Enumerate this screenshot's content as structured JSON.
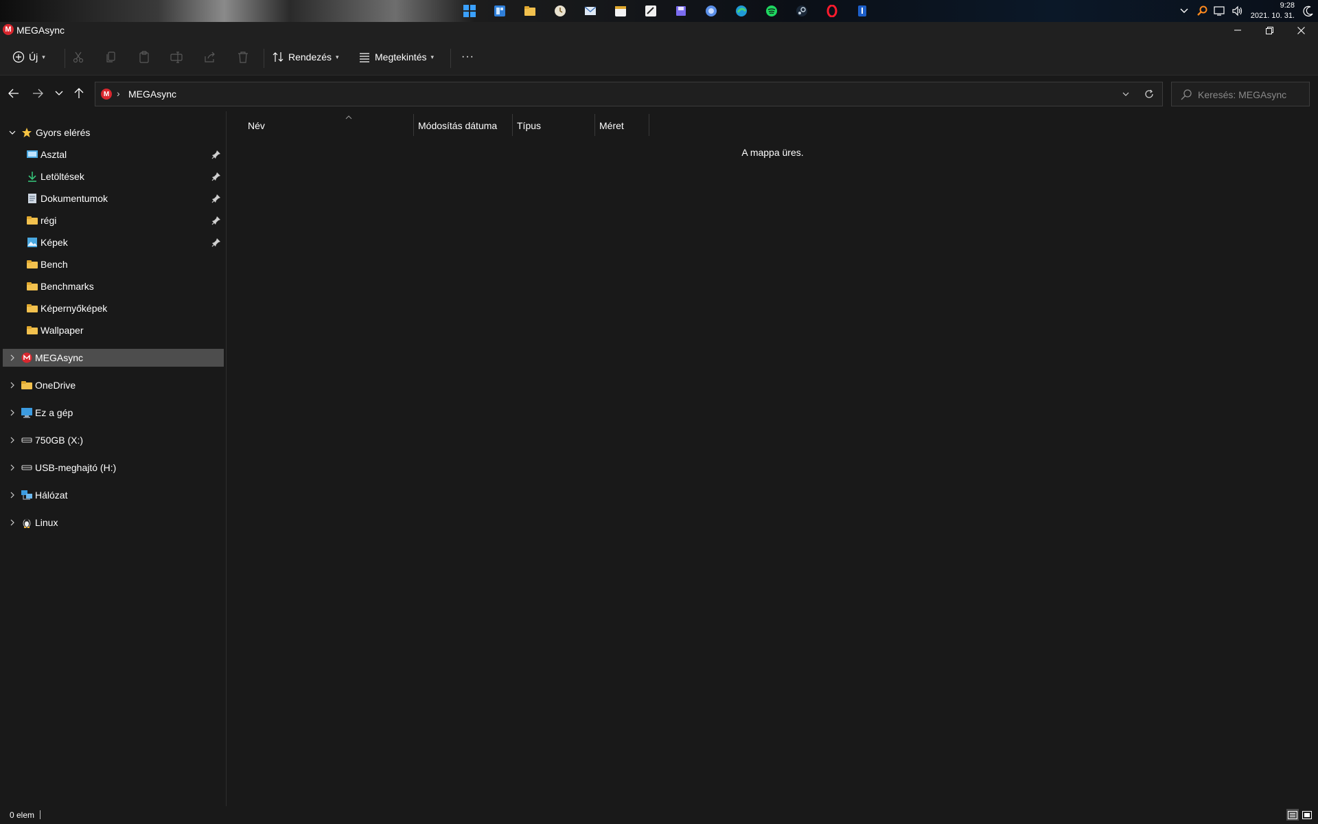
{
  "taskbar": {
    "apps": [
      "windows-start-icon",
      "widgets-icon",
      "file-explorer-icon",
      "clock-app-icon",
      "mail-icon",
      "calendar-icon",
      "notes-icon",
      "save-app-icon",
      "chat-app-icon",
      "edge-icon",
      "spotify-icon",
      "steam-icon",
      "opera-icon",
      "security-icon"
    ],
    "tray": [
      "chevron-up-icon",
      "search-tray-icon",
      "network-icon",
      "volume-icon"
    ],
    "time": "9:28",
    "date": "2021. 10. 31."
  },
  "window": {
    "title": "MEGAsync",
    "logo_letter": "M",
    "accent": "#d9272e"
  },
  "toolbar": {
    "new_label": "Új",
    "sort_label": "Rendezés",
    "view_label": "Megtekintés",
    "more_label": "···"
  },
  "address": {
    "location": "MEGAsync",
    "logo_letter": "M"
  },
  "search": {
    "placeholder": "Keresés: MEGAsync"
  },
  "nav": {
    "quick_access": "Gyors elérés",
    "pinned": [
      {
        "label": "Asztal",
        "icon": "desktop-icon"
      },
      {
        "label": "Letöltések",
        "icon": "download-icon"
      },
      {
        "label": "Dokumentumok",
        "icon": "document-icon"
      },
      {
        "label": "régi",
        "icon": "folder-icon"
      },
      {
        "label": "Képek",
        "icon": "pictures-icon"
      }
    ],
    "recent": [
      "Bench",
      "Benchmarks",
      "Képernyőképek",
      "Wallpaper"
    ],
    "roots": [
      {
        "label": "MEGAsync",
        "icon": "mega-icon",
        "selected": true
      },
      {
        "label": "OneDrive",
        "icon": "folder-icon"
      },
      {
        "label": "Ez a gép",
        "icon": "this-pc-icon"
      },
      {
        "label": "750GB (X:)",
        "icon": "drive-icon"
      },
      {
        "label": "USB-meghajtó (H:)",
        "icon": "usb-drive-icon"
      },
      {
        "label": "Hálózat",
        "icon": "network-icon"
      },
      {
        "label": "Linux",
        "icon": "linux-icon"
      }
    ]
  },
  "columns": {
    "name": "Név",
    "modified": "Módosítás dátuma",
    "type": "Típus",
    "size": "Méret"
  },
  "content": {
    "empty_message": "A mappa üres."
  },
  "status": {
    "item_count": "0 elem"
  }
}
